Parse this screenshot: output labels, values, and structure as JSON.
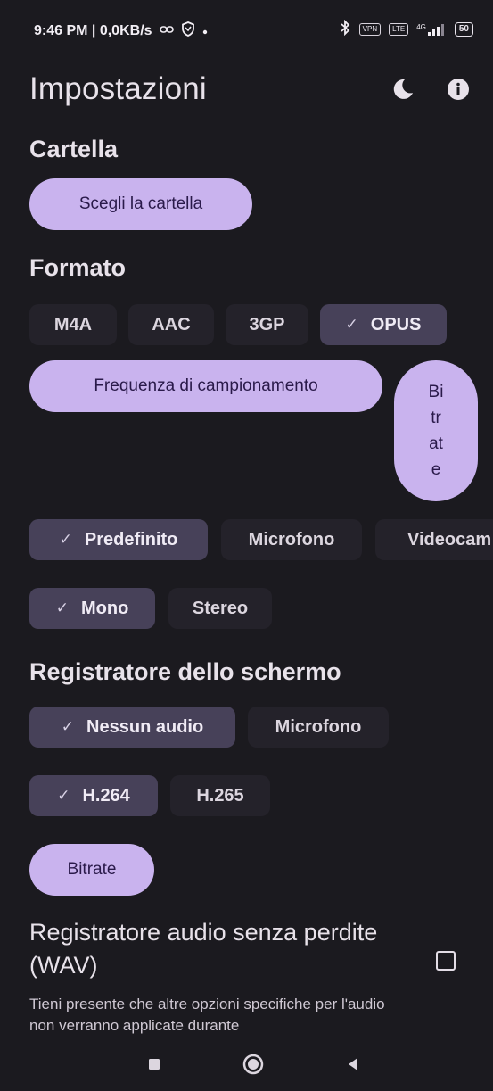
{
  "status_bar": {
    "time_speed": "9:46 PM | 0,0KB/s",
    "vpn_label": "VPN",
    "lte_label": "LTE",
    "net_label": "4G",
    "battery": "50"
  },
  "header": {
    "title": "Impostazioni"
  },
  "folder": {
    "title": "Cartella",
    "choose_label": "Scegli la cartella"
  },
  "format": {
    "title": "Formato",
    "options": [
      "M4A",
      "AAC",
      "3GP",
      "OPUS"
    ],
    "selected": "OPUS",
    "sample_rate_label": "Frequenza di campionamento",
    "bitrate_lines": [
      "Bi",
      "tr",
      "at",
      "e"
    ]
  },
  "source": {
    "options": [
      "Predefinito",
      "Microfono",
      "Videocam"
    ],
    "selected": "Predefinito"
  },
  "channels": {
    "options": [
      "Mono",
      "Stereo"
    ],
    "selected": "Mono"
  },
  "screen_recorder": {
    "title": "Registratore dello schermo",
    "audio_options": [
      "Nessun audio",
      "Microfono"
    ],
    "audio_selected": "Nessun audio",
    "codec_options": [
      "H.264",
      "H.265"
    ],
    "codec_selected": "H.264",
    "bitrate_label": "Bitrate"
  },
  "wav": {
    "title": "Registratore audio senza perdite (WAV)",
    "description": "Tieni presente che altre opzioni specifiche per l'audio non verranno applicate durante",
    "checked": false
  },
  "colors": {
    "background": "#1b1a1f",
    "accent": "#c9b3ee",
    "chip_selected": "#474159",
    "chip": "#24222a"
  }
}
